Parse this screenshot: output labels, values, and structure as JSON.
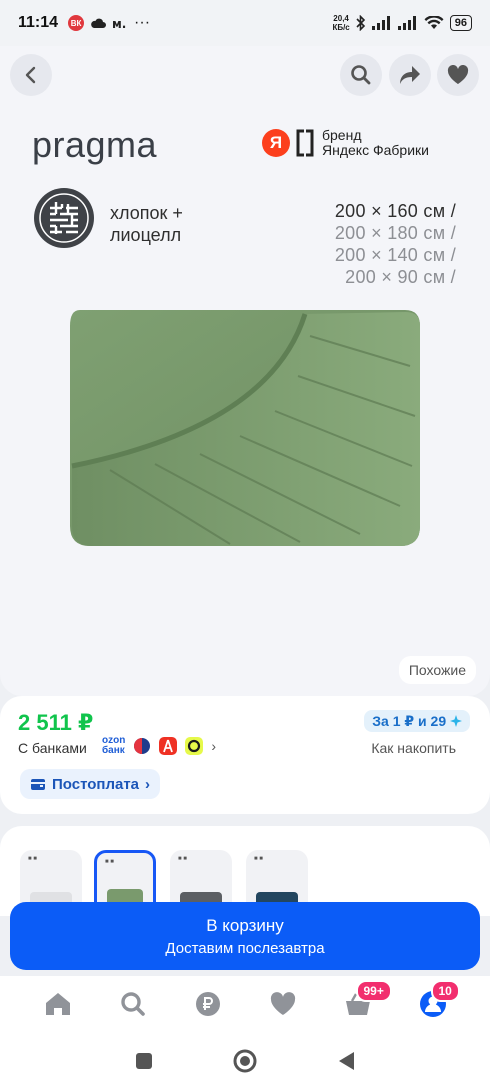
{
  "status_bar": {
    "time": "11:14",
    "vk_label": "ВК",
    "dots": "···",
    "net_speed_value": "20,4",
    "net_speed_unit": "КБ/с",
    "battery": "96"
  },
  "product": {
    "brand": "pragma",
    "badge_letter": "Я",
    "badge_text_line1": "бренд",
    "badge_text_line2": "Яндекс Фабрики",
    "material_line1": "хлопок +",
    "material_line2": "лиоцелл",
    "sizes": [
      "200 × 160 см /",
      "200 × 180 см /",
      "200 × 140 см /",
      "200 × 90 см /"
    ],
    "similar_label": "Похожие",
    "sheet_color": "#7a9a6d"
  },
  "pricing": {
    "price": "2 511 ₽",
    "installment": "За 1 ₽ и 29",
    "banks_label": "С банками",
    "ozon_line1": "ozon",
    "ozon_line2": "банк",
    "accumulate_link": "Как накопить",
    "postpay_label": "Постоплата"
  },
  "variants": [
    {
      "color": "#e8e9ec",
      "selected": false
    },
    {
      "color": "#7a9a6d",
      "selected": true
    },
    {
      "color": "#5c5f63",
      "selected": false
    },
    {
      "color": "#23465f",
      "selected": false
    }
  ],
  "cart": {
    "label": "В корзину",
    "sub": "Доставим послезавтра"
  },
  "bottom_nav": {
    "cart_badge": "99+",
    "profile_badge": "10"
  },
  "colors": {
    "accent": "#0b5cf7",
    "price_green": "#10c44c",
    "badge_pink": "#f22e6e"
  }
}
